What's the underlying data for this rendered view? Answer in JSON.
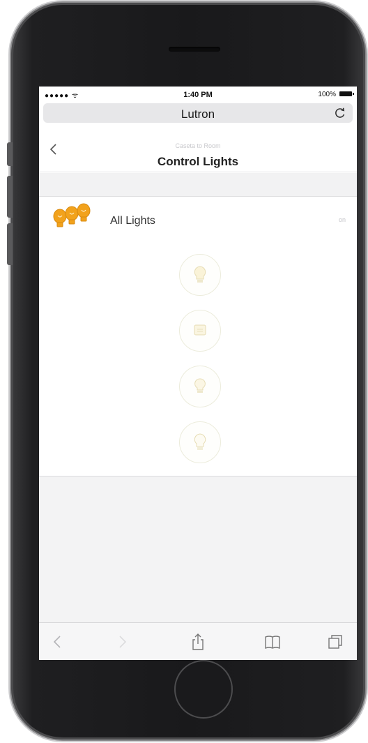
{
  "status_bar": {
    "signal": "●●●●● ᯤ",
    "time": "1:40 PM",
    "battery_percent": "100%"
  },
  "browser": {
    "url_title": "Lutron",
    "reload_icon": "reload-icon"
  },
  "page_header": {
    "breadcrumb": "Caseta to Room",
    "title": "Control Lights",
    "back_icon": "chevron-left-icon"
  },
  "lights": {
    "label": "All Lights",
    "status": "on",
    "bulb_color": "#f0a020"
  },
  "scene_buttons": [
    {
      "icon": "bulb-full-icon"
    },
    {
      "icon": "bulb-medium-icon"
    },
    {
      "icon": "bulb-low-icon"
    },
    {
      "icon": "bulb-off-icon"
    }
  ],
  "toolbar": {
    "items": [
      "back-icon",
      "forward-icon",
      "share-icon",
      "bookmarks-icon",
      "tabs-icon"
    ]
  },
  "colors": {
    "accent_amber": "#f0a020",
    "scene_ring": "#ececdc"
  }
}
